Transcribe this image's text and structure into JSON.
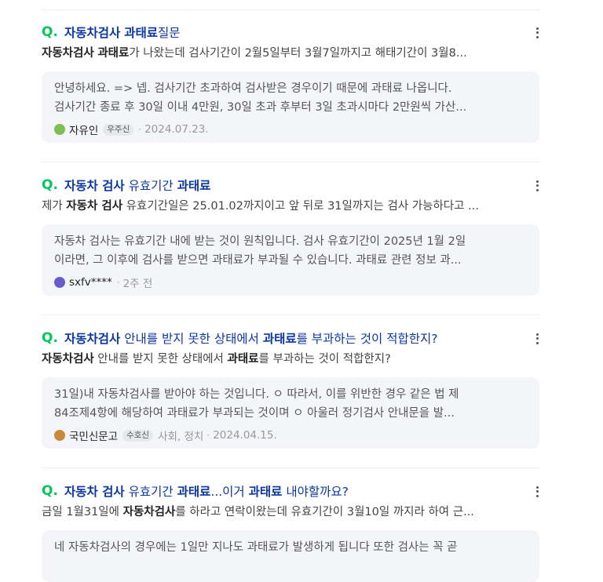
{
  "results": [
    {
      "title": [
        [
          "자동차검사",
          true
        ],
        [
          " ",
          false
        ],
        [
          "과태료",
          true
        ],
        [
          "질문",
          false
        ]
      ],
      "desc": [
        [
          "자동차검사",
          true
        ],
        [
          " ",
          false
        ],
        [
          "과태료",
          true
        ],
        [
          "가 나왔는데 검사기간이 2월5일부터 3월7일까지고 해태기간이 3월8...",
          false
        ]
      ],
      "answer_line1": "안녕하세요. => 넵. 검사기간 초과하여 검사받은 경우이기 때문에 과태료 나옵니다.",
      "answer_line2": "검사기간 종료 후 30일 이내 4만원, 30일 초과 후부터 3일 초과시마다 2만원씩 가산...",
      "author": "자유인",
      "badge": "우주신",
      "category": "",
      "date": "2024.07.23.",
      "avatar_color": "#7cbf52"
    },
    {
      "title": [
        [
          "자동차 검사",
          true
        ],
        [
          " 유효기간 ",
          false
        ],
        [
          "과태료",
          true
        ]
      ],
      "desc": [
        [
          "제가 ",
          false
        ],
        [
          "자동차 검사",
          true
        ],
        [
          " 유효기간일은 25.01.02까지이고 앞 뒤로 31일까지는 검사 가능하다고 ...",
          false
        ]
      ],
      "answer_line1": "자동차 검사는 유효기간 내에 받는 것이 원칙입니다. 검사 유효기간이 2025년 1월 2일",
      "answer_line2": "이라면, 그 이후에 검사를 받으면 과태료가 부과될 수 있습니다. 과태료 관련 정보 과...",
      "author": "sxfv****",
      "badge": "",
      "category": "",
      "date": "2주 전",
      "avatar_color": "#6a5acd"
    },
    {
      "title": [
        [
          "자동차검사",
          true
        ],
        [
          " 안내를 받지 못한 상태에서 ",
          false
        ],
        [
          "과태료",
          true
        ],
        [
          "를 부과하는 것이 적합한지?",
          false
        ]
      ],
      "desc": [
        [
          "자동차검사",
          true
        ],
        [
          " 안내를 받지 못한 상태에서 ",
          false
        ],
        [
          "과태료",
          true
        ],
        [
          "를 부과하는 것이 적합한지?",
          false
        ]
      ],
      "answer_line1": "31일)내 자동차검사를 받아야 하는 것입니다. ㅇ 따라서, 이를 위반한 경우 같은 법 제",
      "answer_line2": "84조제4항에 해당하여 과태료가 부과되는 것이며 ㅇ 아울러 정기검사 안내문을 발...",
      "author": "국민신문고",
      "badge": "수호신",
      "category": "사회, 정치",
      "date": "2024.04.15.",
      "avatar_color": "#c98a3a"
    },
    {
      "title": [
        [
          "자동차 검사",
          true
        ],
        [
          " 유효기간 ",
          false
        ],
        [
          "과태료",
          true
        ],
        [
          "...이거 ",
          false
        ],
        [
          "과태료",
          true
        ],
        [
          " 내야할까요?",
          false
        ]
      ],
      "desc": [
        [
          "금일 1월31일에 ",
          false
        ],
        [
          "자동차검사",
          true
        ],
        [
          "를 하라고 연락이왔는데 유효기간이 3월10일 까지라 하여 근...",
          false
        ]
      ],
      "answer_line1": "네 자동차검사의 경우에는 1일만 지나도 과태료가 발생하게 됩니다 또한 검사는 꼭 곧",
      "answer_line2": "",
      "author": "",
      "badge": "",
      "category": "",
      "date": "",
      "avatar_color": "#999999"
    }
  ]
}
